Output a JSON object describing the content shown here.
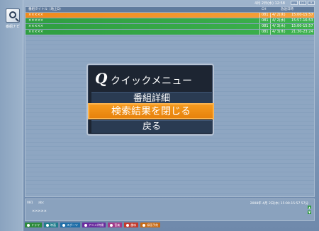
{
  "header": {
    "clock": "4月 2日(水) 12:58",
    "window_buttons": [
      "_",
      "□",
      "×"
    ]
  },
  "sidebar": {
    "icon": "search-icon",
    "label": "番組ナビ"
  },
  "list": {
    "columns": {
      "title": "番組タイトル（地上D）",
      "ch": "CH",
      "datetime": "放送日時"
    },
    "rows": [
      {
        "title": "×××××",
        "ch": "081",
        "date": "4/ 2(水)",
        "time": "15:00-15:57",
        "color": "#f08a1c"
      },
      {
        "title": "×××××",
        "ch": "081",
        "date": "4/ 2(水)",
        "time": "15:57-16:53",
        "color": "#2f9e41"
      },
      {
        "title": "×××××",
        "ch": "081",
        "date": "4/ 3(木)",
        "time": "15:00-15:57",
        "color": "#2f9e41"
      },
      {
        "title": "×××××",
        "ch": "081",
        "date": "4/ 3(木)",
        "time": "21:30-23:24",
        "color": "#2f9e41"
      }
    ]
  },
  "quick_menu": {
    "title": "クイックメニュー",
    "icon": "quick-menu-icon",
    "items": [
      {
        "label": "番組詳細",
        "selected": false
      },
      {
        "label": "検索結果を閉じる",
        "selected": true
      },
      {
        "label": "戻る",
        "selected": false
      }
    ]
  },
  "info": {
    "channel": "081",
    "station": "abc",
    "datetime": "2008年 4月 2日(水) 15:00-15:57  57分",
    "title": "×××××"
  },
  "legend": [
    {
      "label": "ドラマ",
      "color": "#2c8b3a"
    },
    {
      "label": "映画",
      "color": "#1f7d8c"
    },
    {
      "label": "スポーツ",
      "color": "#1f6ea8"
    },
    {
      "label": "アニメ/特撮",
      "color": "#6a2c9e"
    },
    {
      "label": "音楽",
      "color": "#a33a8a"
    },
    {
      "label": "趣味",
      "color": "#c43a2c"
    },
    {
      "label": "録画予約",
      "color": "#c76a14"
    }
  ]
}
